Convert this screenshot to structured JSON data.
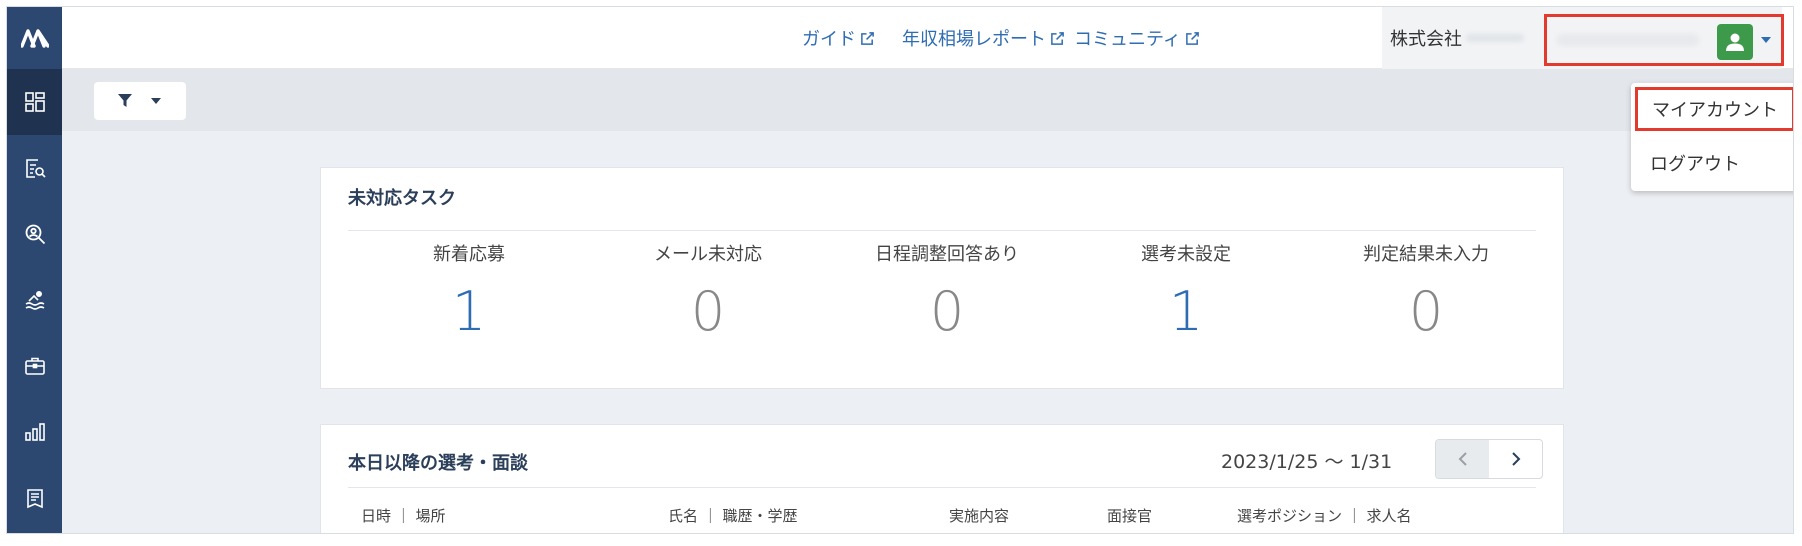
{
  "header": {
    "links": [
      {
        "label": "ガイド",
        "icon": "external-link-icon"
      },
      {
        "label": "年収相場レポート",
        "icon": "external-link-icon"
      },
      {
        "label": "コミュニティ",
        "icon": "external-link-icon"
      }
    ],
    "company_label": "株式会社",
    "user_menu_icon": "chevron-down-icon"
  },
  "sidebar": {
    "logo_icon": "logo-icon",
    "items": [
      {
        "icon": "dashboard-icon"
      },
      {
        "icon": "document-search-icon"
      },
      {
        "icon": "person-search-icon"
      },
      {
        "icon": "swimmer-icon"
      },
      {
        "icon": "briefcase-icon"
      },
      {
        "icon": "bar-chart-icon"
      },
      {
        "icon": "forms-icon"
      }
    ]
  },
  "filter": {
    "icon": "filter-icon"
  },
  "tasks": {
    "title": "未対応タスク",
    "items": [
      {
        "label": "新着応募",
        "value": "1"
      },
      {
        "label": "メール未対応",
        "value": "0"
      },
      {
        "label": "日程調整回答あり",
        "value": "0"
      },
      {
        "label": "選考未設定",
        "value": "1"
      },
      {
        "label": "判定結果未入力",
        "value": "0"
      }
    ]
  },
  "schedule": {
    "title": "本日以降の選考・面談",
    "date_range": "2023/1/25 〜 1/31",
    "columns": [
      "日時 ｜ 場所",
      "氏名 ｜ 職歴・学歴",
      "実施内容",
      "面接官",
      "選考ポジション ｜ 求人名"
    ]
  },
  "dropdown": {
    "items": [
      "マイアカウント",
      "ログアウト"
    ]
  },
  "colors": {
    "sidebar": "#2c4870",
    "accent": "#2f6db2",
    "highlight": "#e23a2c",
    "avatar": "#3d9a4a"
  }
}
